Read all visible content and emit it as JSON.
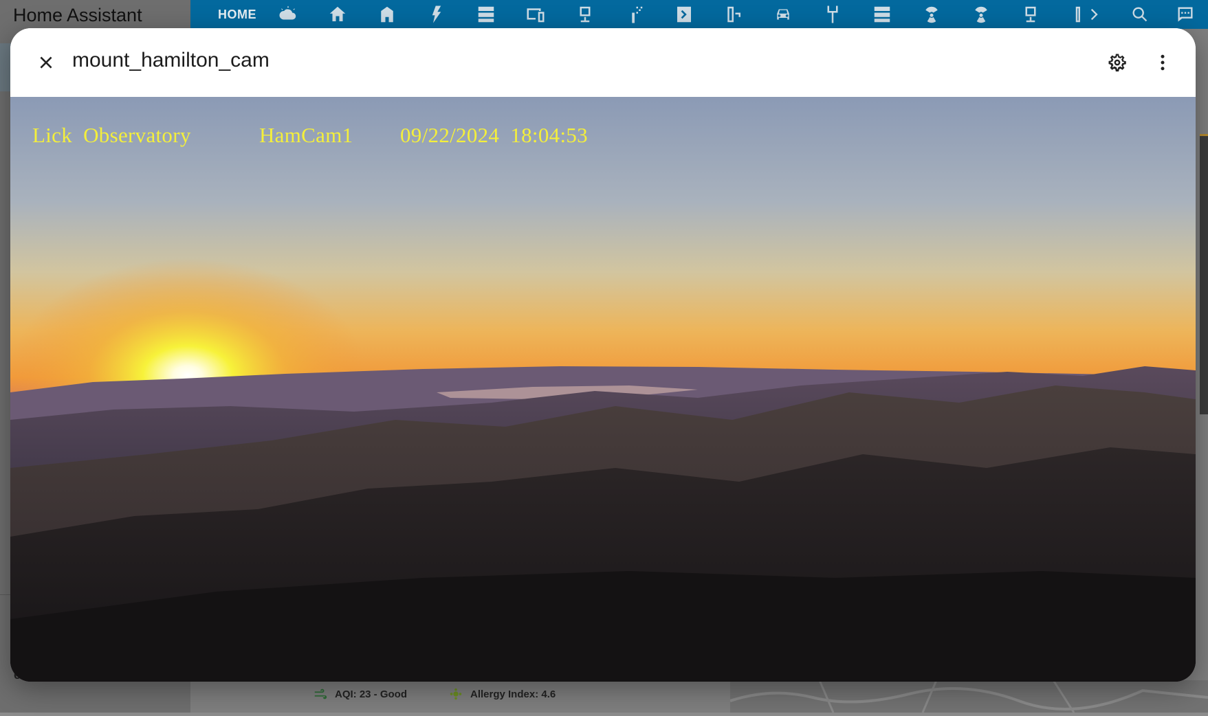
{
  "app": {
    "title": "Home Assistant",
    "sidebar_fragment": "e"
  },
  "topbar": {
    "home_tab": "HOME",
    "tab_icons": [
      "weather-partly-cloudy-icon",
      "home-tree-icon",
      "home-city-icon",
      "lightning-bolt-icon",
      "server-icon",
      "monitor-cellphone-icon",
      "presentation-icon",
      "sprinkler-icon",
      "chevron-right-box-icon",
      "water-pump-icon",
      "car-icon",
      "antenna-icon",
      "server-icon",
      "radiation-icon",
      "radiation-icon",
      "presentation-icon",
      "gauge-icon"
    ],
    "right_icons": [
      "chevron-right-icon",
      "search-icon",
      "assist-chat-icon"
    ]
  },
  "footer": {
    "aqi": "AQI: 23 - Good",
    "allergy": "Allergy Index: 4.6"
  },
  "dialog": {
    "title": "mount_hamilton_cam",
    "close_icon": "close-icon",
    "settings_icon": "cog-icon",
    "more_icon": "dots-vertical-icon"
  },
  "camera": {
    "overlay_site": "Lick  Observatory",
    "overlay_cam": "HamCam1",
    "overlay_timestamp": "09/22/2024  18:04:53"
  },
  "colors": {
    "topbar": "#03699e",
    "overlay_text": "#f4ef3b",
    "dialog_bg": "#ffffff"
  }
}
